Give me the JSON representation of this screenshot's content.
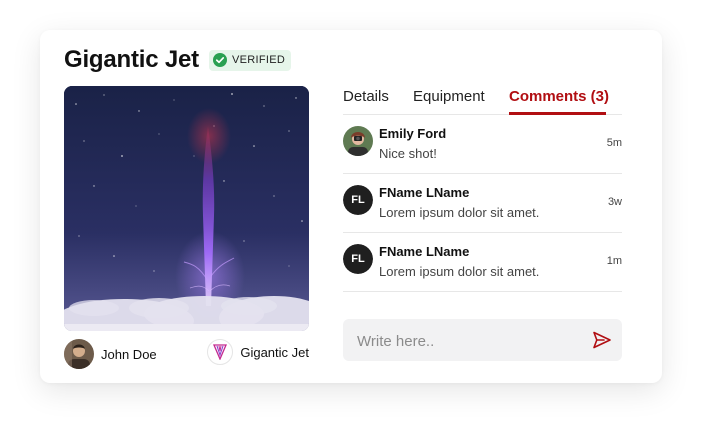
{
  "post": {
    "title": "Gigantic Jet",
    "badge": "VERIFIED",
    "author_name": "John Doe",
    "category_name": "Gigantic Jet"
  },
  "tabs": {
    "details": "Details",
    "equipment": "Equipment",
    "comments": "Comments (3)",
    "active": "comments"
  },
  "comments": [
    {
      "name": "Emily Ford",
      "text": "Nice shot!",
      "time": "5m",
      "avatar": "photo"
    },
    {
      "name": "FName LName",
      "text": "Lorem ipsum dolor sit amet.",
      "time": "3w",
      "initials": "FL"
    },
    {
      "name": "FName LName",
      "text": "Lorem ipsum dolor sit amet.",
      "time": "1m",
      "initials": "FL"
    }
  ],
  "composer": {
    "placeholder": "Write here.."
  },
  "colors": {
    "accent": "#b10e12",
    "badge_bg": "#e6f5ea",
    "badge_check": "#2aa052",
    "sky": "#1d2446"
  },
  "icons": {
    "verified": "check-circle-icon",
    "send": "send-icon",
    "category": "gigantic-jet-logo-icon"
  }
}
